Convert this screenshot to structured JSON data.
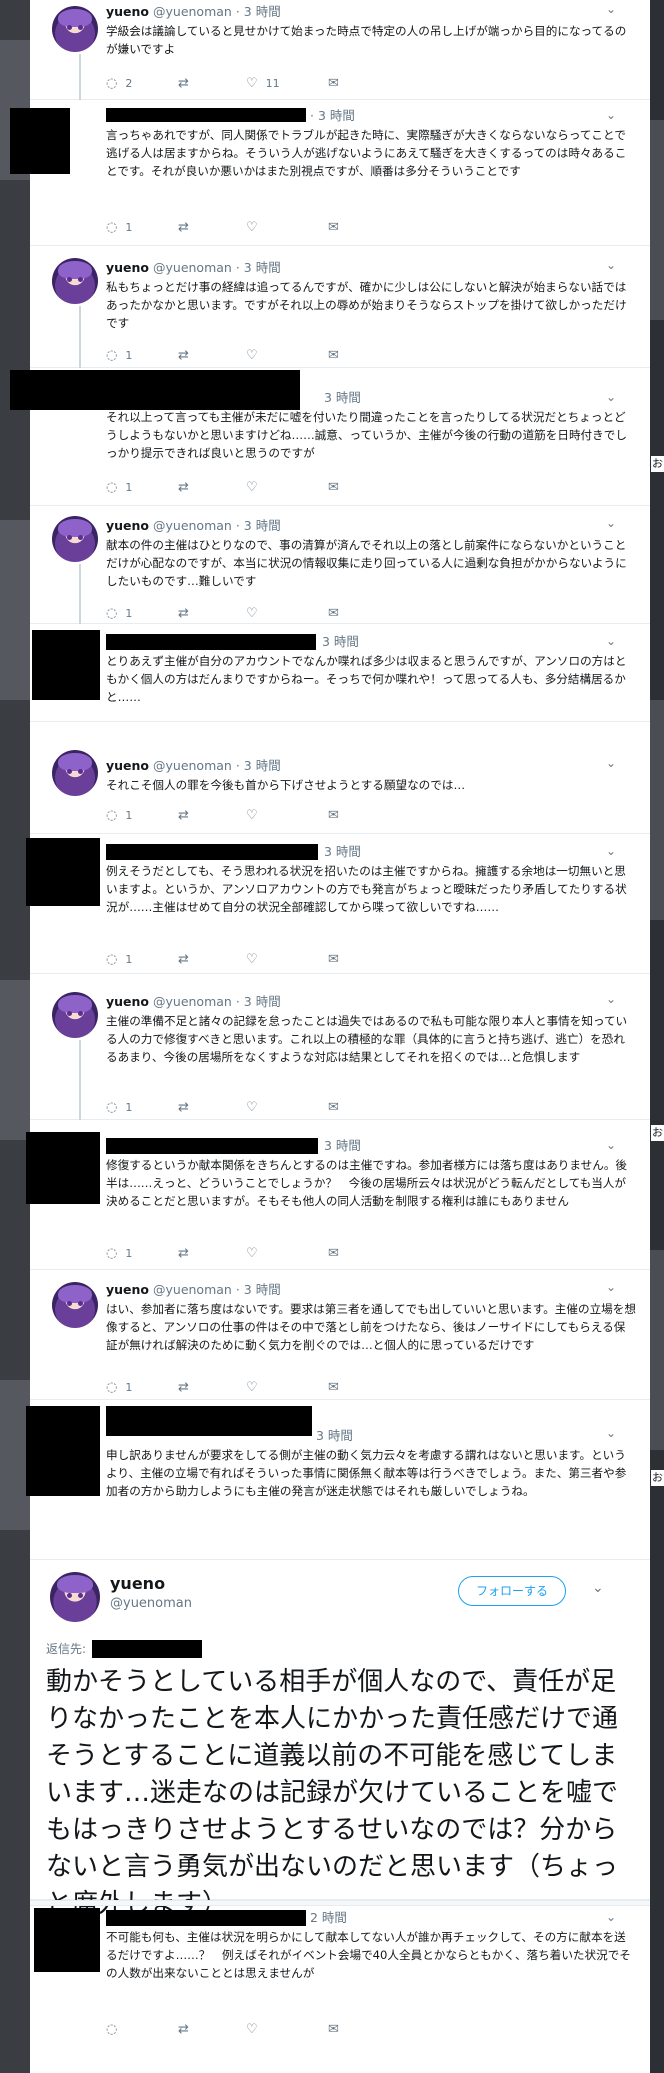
{
  "colors": {
    "text": "#14171a",
    "muted": "#657786",
    "accent": "#1da1f2",
    "divider": "#e6ecf0"
  },
  "icons": {
    "reply": "reply-icon",
    "retweet": "retweet-icon",
    "like": "heart-icon",
    "dm": "envelope-icon",
    "caret": "chevron-down-icon"
  },
  "side_chars": [
    "お",
    "お",
    "お"
  ],
  "tweets": [
    {
      "name": "yueno",
      "handle": "@yuenoman",
      "time": "· 3 時間",
      "text": "学級会は議論していると見せかけて始まった時点で特定の人の吊し上げが端っから目的になってるのが嫌いですよ",
      "replies": "2",
      "retweets": "",
      "likes": "11"
    },
    {
      "time": "· 3 時間",
      "text": "言っちゃあれですが、同人関係でトラブルが起きた時に、実際騒ぎが大きくならないならってことで逃げる人は居ますからね。そういう人が逃げないようにあえて騒ぎを大きくするってのは時々あることです。それが良いか悪いかはまた別視点ですが、順番は多分そういうことです",
      "replies": "1",
      "retweets": "",
      "likes": ""
    },
    {
      "name": "yueno",
      "handle": "@yuenoman",
      "time": "· 3 時間",
      "text": "私もちょっとだけ事の経緯は追ってるんですが、確かに少しは公にしないと解決が始まらない話ではあったかなかと思います。ですがそれ以上の辱めが始まりそうならストップを掛けて欲しかっただけです",
      "replies": "1",
      "retweets": "",
      "likes": ""
    },
    {
      "time": "3 時間",
      "text": "それ以上って言っても主催が未だに嘘を付いたり間違ったことを言ったりしてる状況だとちょっとどうしようもないかと思いますけどね……誠意、っていうか、主催が今後の行動の道筋を日時付きでしっかり提示できれば良いと思うのですが",
      "replies": "1",
      "retweets": "",
      "likes": ""
    },
    {
      "name": "yueno",
      "handle": "@yuenoman",
      "time": "· 3 時間",
      "text": "献本の件の主催はひとりなので、事の清算が済んでそれ以上の落とし前案件にならないかということだけが心配なのですが、本当に状況の情報収集に走り回っている人に過剰な負担がかからないようにしたいものです…難しいです",
      "replies": "1",
      "retweets": "",
      "likes": ""
    },
    {
      "time": "3 時間",
      "text": "とりあえず主催が自分のアカウントでなんか喋れば多少は収まると思うんですが、アンソロの方はともかく個人の方はだんまりですからねー。そっちで何か喋れや！って思ってる人も、多分結構居るかと……",
      "replies": "1",
      "retweets": "",
      "likes": ""
    },
    {
      "name": "yueno",
      "handle": "@yuenoman",
      "time": "· 3 時間",
      "text": "それこそ個人の罪を今後も首から下げさせようとする願望なのでは…",
      "replies": "1",
      "retweets": "",
      "likes": ""
    },
    {
      "time": "3 時間",
      "text": "例えそうだとしても、そう思われる状況を招いたのは主催ですからね。擁護する余地は一切無いと思いますよ。というか、アンソロアカウントの方でも発言がちょっと曖昧だったり矛盾してたりする状況が……主催はせめて自分の状況全部確認してから喋って欲しいですね……",
      "replies": "1",
      "retweets": "",
      "likes": ""
    },
    {
      "name": "yueno",
      "handle": "@yuenoman",
      "time": "· 3 時間",
      "text": "主催の準備不足と諸々の記録を怠ったことは過失ではあるので私も可能な限り本人と事情を知っている人の力で修復すべきと思います。これ以上の積極的な罪（具体的に言うと持ち逃げ、逃亡）を恐れるあまり、今後の居場所をなくすような対応は結果としてそれを招くのでは…と危惧します",
      "replies": "1",
      "retweets": "",
      "likes": ""
    },
    {
      "time": "3 時間",
      "text": "修復するというか献本関係をきちんとするのは主催ですね。参加者様方には落ち度はありません。後半は……えっと、どういうことでしょうか？　今後の居場所云々は状況がどう転んだとしても当人が決めることだと思いますが。そもそも他人の同人活動を制限する権利は誰にもありません",
      "replies": "1",
      "retweets": "",
      "likes": ""
    },
    {
      "name": "yueno",
      "handle": "@yuenoman",
      "time": "· 3 時間",
      "text": "はい、参加者に落ち度はないです。要求は第三者を通してでも出していいと思います。主催の立場を想像すると、アンソロの仕事の件はその中で落とし前をつけたなら、後はノーサイドにしてもらえる保証が無ければ解決のために動く気力を削ぐのでは…と個人的に思っているだけです",
      "replies": "1",
      "retweets": "",
      "likes": ""
    },
    {
      "time": "3 時間",
      "text": "申し訳ありませんが要求をしてる側が主催の動く気力云々を考慮する謂れはないと思います。というより、主催の立場で有ればそういった事情に関係無く献本等は行うべきでしょう。また、第三者や参加者の方から助力しようにも主催の発言が迷走状態ではそれも厳しいでしょうね。",
      "replies": "",
      "retweets": "",
      "likes": ""
    }
  ],
  "focal": {
    "name": "yueno",
    "handle": "@yuenoman",
    "follow_label": "フォローする",
    "reply_to_label": "返信先:",
    "text": "動かそうとしている相手が個人なので、責任が足りなかったことを本人にかかった責任感だけで通そうとすることに道義以前の不可能を感じてしまいます…迷走なのは記録が欠けていることを嘘でもはっきりさせようとするせいなのでは？分からないと言う勇気が出ないのだと思います（ちょっと席外します）"
  },
  "last_tweet": {
    "time": "2 時間",
    "text": "不可能も何も、主催は状況を明らかにして献本してない人が誰か再チェックして、その方に献本を送るだけですよ……？　例えばそれがイベント会場で40人全員とかならともかく、落ち着いた状況でその人数が出来ないこととは思えませんが",
    "replies": "",
    "retweets": "",
    "likes": ""
  }
}
